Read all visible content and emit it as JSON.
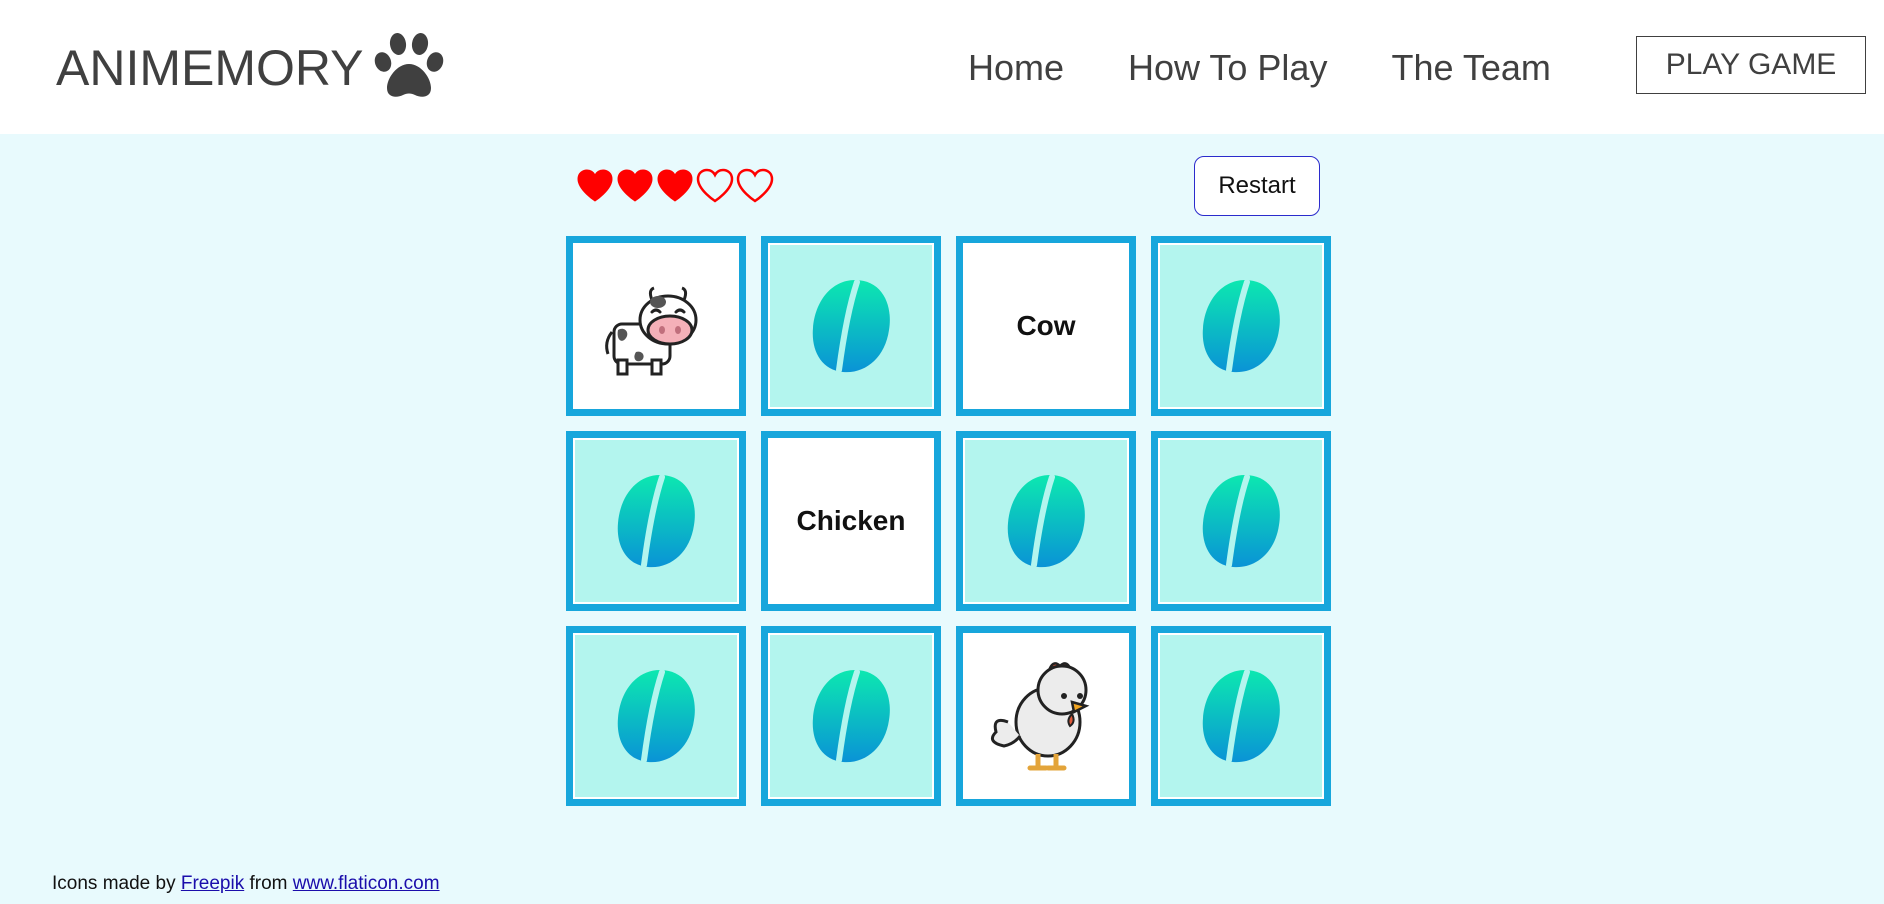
{
  "brand": {
    "name": "ANIMEMORY",
    "logo_icon": "paw-icon"
  },
  "nav": {
    "links": [
      "Home",
      "How To Play",
      "The Team"
    ],
    "play_button": "PLAY GAME"
  },
  "game": {
    "lives_total": 5,
    "lives_remaining": 3,
    "heart_color": "#ff0000",
    "restart_label": "Restart",
    "card_border_color": "#17a6dc",
    "card_back_color": "#b3f5ee",
    "cards": [
      {
        "state": "face",
        "kind": "image",
        "icon": "cow-icon"
      },
      {
        "state": "back",
        "icon": "leaf-icon"
      },
      {
        "state": "face",
        "kind": "word",
        "text": "Cow"
      },
      {
        "state": "back",
        "icon": "leaf-icon"
      },
      {
        "state": "back",
        "icon": "leaf-icon"
      },
      {
        "state": "face",
        "kind": "word",
        "text": "Chicken"
      },
      {
        "state": "back",
        "icon": "leaf-icon"
      },
      {
        "state": "back",
        "icon": "leaf-icon"
      },
      {
        "state": "back",
        "icon": "leaf-icon"
      },
      {
        "state": "back",
        "icon": "leaf-icon"
      },
      {
        "state": "face",
        "kind": "image",
        "icon": "chicken-icon"
      },
      {
        "state": "back",
        "icon": "leaf-icon"
      }
    ]
  },
  "footer": {
    "prefix": "Icons made by",
    "author_link": "Freepik",
    "middle": "from",
    "site_link": "www.flaticon.com"
  }
}
